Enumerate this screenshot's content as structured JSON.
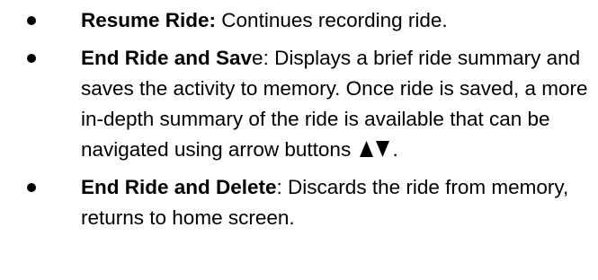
{
  "items": [
    {
      "term": "Resume Ride:",
      "text": " Continues recording ride."
    },
    {
      "term_main": "End Ride and Sav",
      "term_tail": "e",
      "text": ": Displays a brief ride summary and saves the activity to memory. Once ride is saved, a more in-depth summary of the ride is available that can be navigated using arrow buttons ",
      "icons": [
        "arrow-up-icon",
        "arrow-down-icon"
      ],
      "end": "."
    },
    {
      "term": "End Ride and Delete",
      "text": ": Discards the ride from memory, returns to home screen."
    }
  ]
}
